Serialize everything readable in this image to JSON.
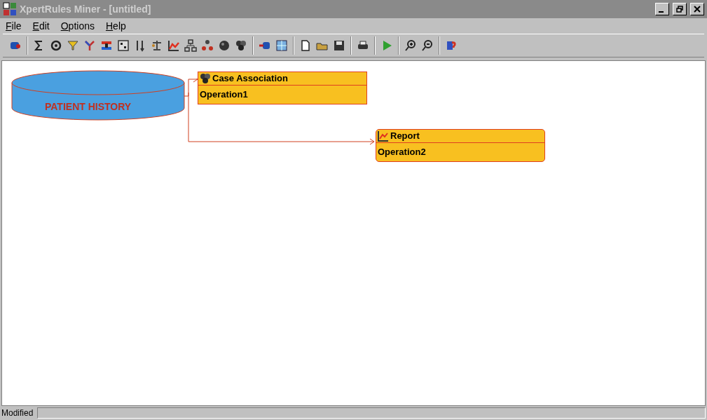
{
  "window": {
    "title": "XpertRules Miner - [untitled]"
  },
  "menu": [
    {
      "accel": "F",
      "rest": "ile"
    },
    {
      "accel": "E",
      "rest": "dit"
    },
    {
      "accel": "O",
      "rest": "ptions"
    },
    {
      "accel": "H",
      "rest": "elp"
    }
  ],
  "canvas": {
    "source": {
      "label": "PATIENT HISTORY"
    },
    "operations": [
      {
        "kind": "association",
        "title": "Case Association",
        "name": "Operation1"
      },
      {
        "kind": "report",
        "title": "Report",
        "name": "Operation2"
      }
    ]
  },
  "status_bar": {
    "text": "Modified"
  }
}
